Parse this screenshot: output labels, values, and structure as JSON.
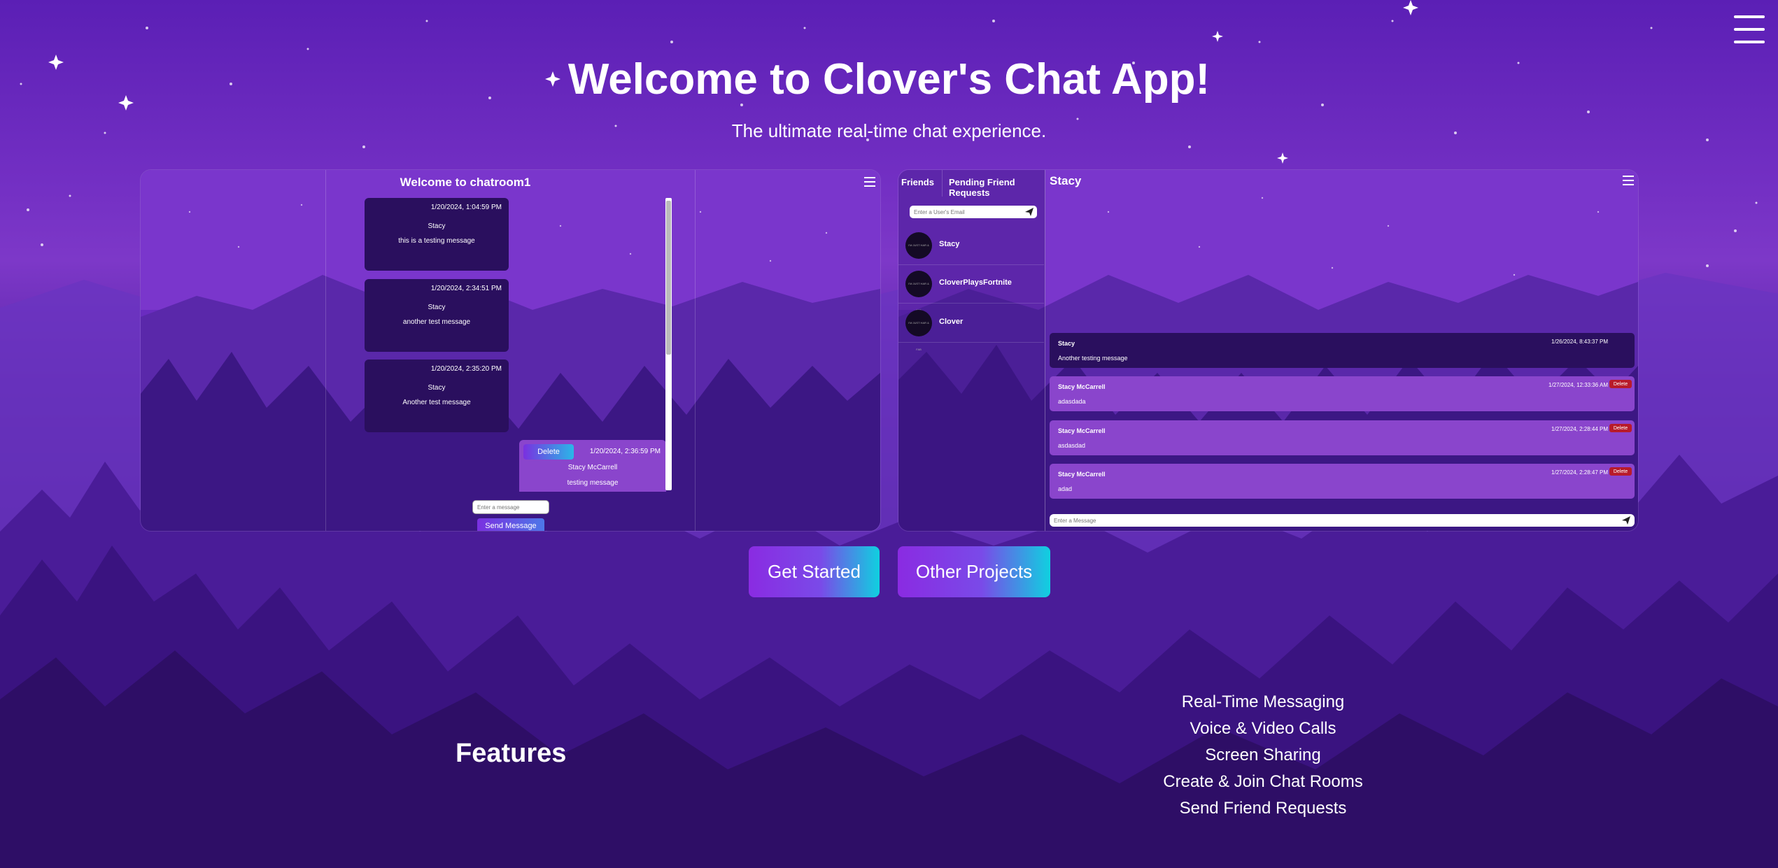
{
  "page": {
    "title": "Welcome to Clover's Chat App!",
    "subtitle": "The ultimate real-time chat experience."
  },
  "chatroom_preview": {
    "title": "Welcome to chatroom1",
    "messages": [
      {
        "time": "1/20/2024, 1:04:59 PM",
        "sender": "Stacy",
        "text": "this is a testing message"
      },
      {
        "time": "1/20/2024, 2:34:51 PM",
        "sender": "Stacy",
        "text": "another test message"
      },
      {
        "time": "1/20/2024, 2:35:20 PM",
        "sender": "Stacy",
        "text": "Another test message"
      }
    ],
    "own_message": {
      "delete_label": "Delete",
      "time": "1/20/2024, 2:36:59 PM",
      "sender": "Stacy McCarrell",
      "text": "testing message"
    },
    "input_placeholder": "Enter a message",
    "send_label": "Send Message"
  },
  "dm_preview": {
    "tabs": [
      "Friends",
      "Pending Friend Requests"
    ],
    "email_placeholder": "Enter a User's Email",
    "friends": [
      "Stacy",
      "CloverPlaysFortnite",
      "Clover"
    ],
    "avatar_text": "I'M JUST HAR & FAB",
    "peer": "Stacy",
    "messages": [
      {
        "sender": "Stacy",
        "time": "1/26/2024, 8:43:37 PM",
        "text": "Another testing message",
        "own": false
      },
      {
        "sender": "Stacy McCarrell",
        "time": "1/27/2024, 12:33:36 AM",
        "text": "adasdada",
        "own": true
      },
      {
        "sender": "Stacy McCarrell",
        "time": "1/27/2024, 2:28:44 PM",
        "text": "asdasdad",
        "own": true
      },
      {
        "sender": "Stacy McCarrell",
        "time": "1/27/2024, 2:28:47 PM",
        "text": "adad",
        "own": true
      }
    ],
    "delete_label": "Delete",
    "input_placeholder": "Enter a Message"
  },
  "buttons": {
    "get_started": "Get Started",
    "other_projects": "Other Projects"
  },
  "features": {
    "heading": "Features",
    "items": [
      "Real-Time Messaging",
      "Voice & Video Calls",
      "Screen Sharing",
      "Create & Join Chat Rooms",
      "Send Friend Requests"
    ]
  },
  "icons": [
    "menu-icon",
    "send-icon"
  ],
  "colors": {
    "accent_start": "#8a2be2",
    "accent_end": "#10d0e0",
    "delete_red": "#b81b2a"
  }
}
